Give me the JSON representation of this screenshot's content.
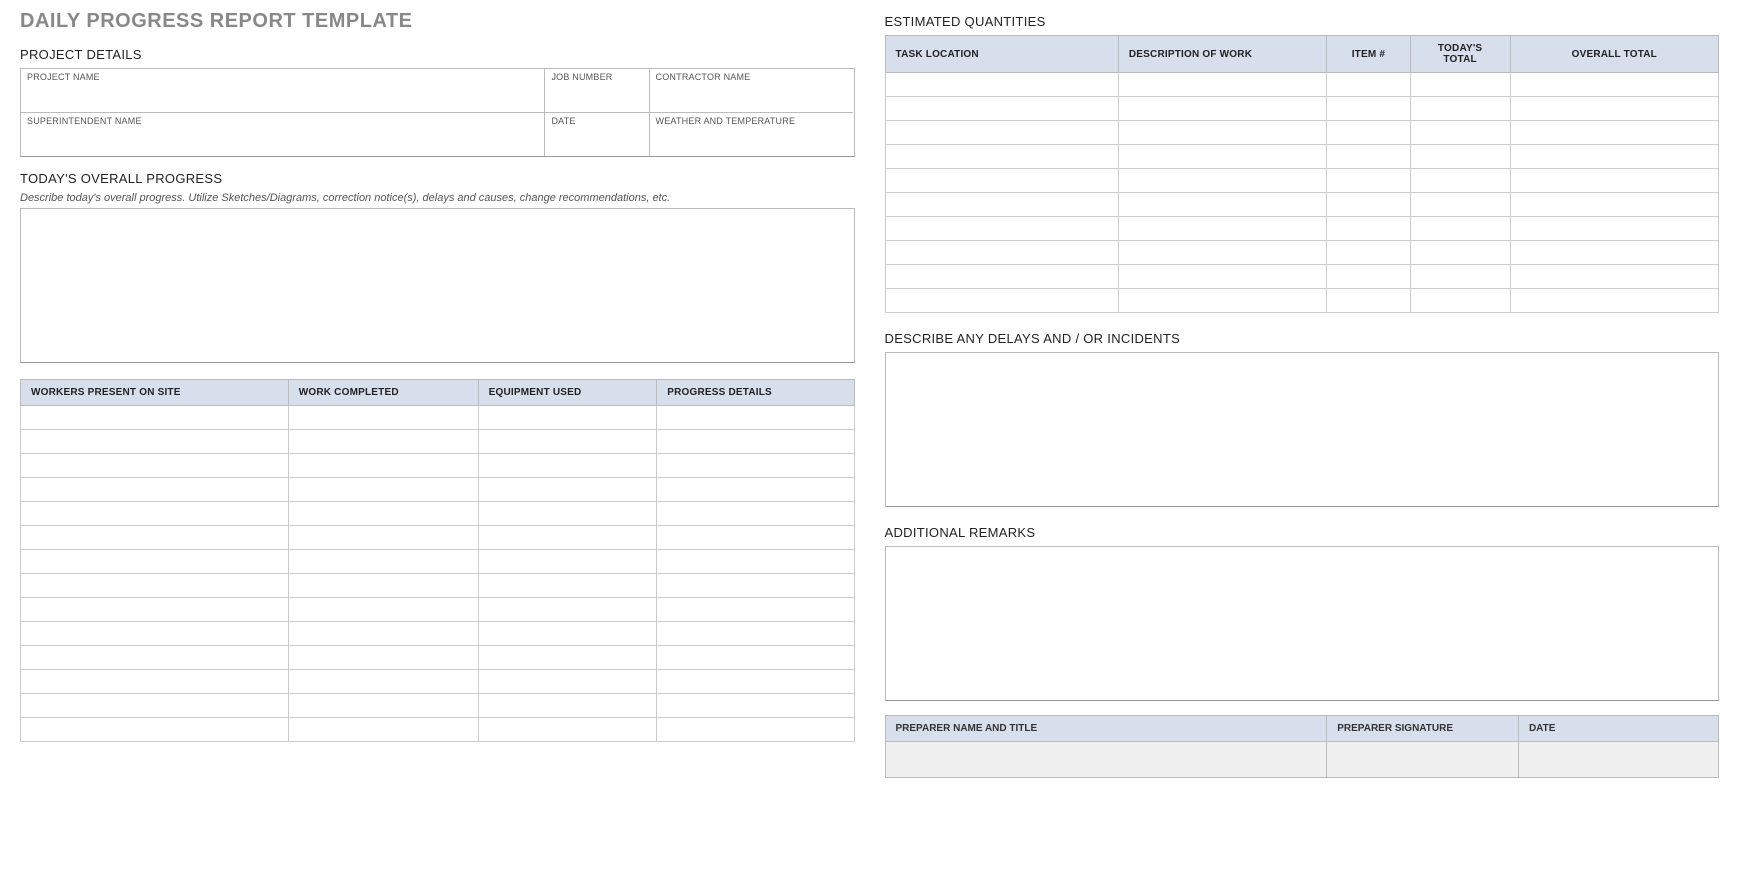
{
  "title": "DAILY PROGRESS REPORT TEMPLATE",
  "project_details": {
    "heading": "PROJECT DETAILS",
    "labels": {
      "project_name": "PROJECT NAME",
      "job_number": "JOB NUMBER",
      "contractor_name": "CONTRACTOR NAME",
      "superintendent_name": "SUPERINTENDENT NAME",
      "date": "DATE",
      "weather_temp": "WEATHER AND TEMPERATURE"
    },
    "values": {
      "project_name": "",
      "job_number": "",
      "contractor_name": "",
      "superintendent_name": "",
      "date": "",
      "weather_temp": ""
    }
  },
  "overall_progress": {
    "heading": "TODAY'S OVERALL PROGRESS",
    "instruction": "Describe today's overall progress.  Utilize Sketches/Diagrams, correction notice(s), delays and causes, change recommendations, etc.",
    "value": ""
  },
  "progress_table": {
    "headers": [
      "WORKERS PRESENT ON SITE",
      "WORK COMPLETED",
      "EQUIPMENT USED",
      "PROGRESS DETAILS"
    ],
    "rows": [
      [
        "",
        "",
        "",
        ""
      ],
      [
        "",
        "",
        "",
        ""
      ],
      [
        "",
        "",
        "",
        ""
      ],
      [
        "",
        "",
        "",
        ""
      ],
      [
        "",
        "",
        "",
        ""
      ],
      [
        "",
        "",
        "",
        ""
      ],
      [
        "",
        "",
        "",
        ""
      ],
      [
        "",
        "",
        "",
        ""
      ],
      [
        "",
        "",
        "",
        ""
      ],
      [
        "",
        "",
        "",
        ""
      ],
      [
        "",
        "",
        "",
        ""
      ],
      [
        "",
        "",
        "",
        ""
      ],
      [
        "",
        "",
        "",
        ""
      ],
      [
        "",
        "",
        "",
        ""
      ]
    ]
  },
  "est_quantities": {
    "heading": "ESTIMATED QUANTITIES",
    "headers": [
      "TASK LOCATION",
      "DESCRIPTION OF WORK",
      "ITEM #",
      "TODAY'S TOTAL",
      "OVERALL TOTAL"
    ],
    "rows": [
      [
        "",
        "",
        "",
        "",
        ""
      ],
      [
        "",
        "",
        "",
        "",
        ""
      ],
      [
        "",
        "",
        "",
        "",
        ""
      ],
      [
        "",
        "",
        "",
        "",
        ""
      ],
      [
        "",
        "",
        "",
        "",
        ""
      ],
      [
        "",
        "",
        "",
        "",
        ""
      ],
      [
        "",
        "",
        "",
        "",
        ""
      ],
      [
        "",
        "",
        "",
        "",
        ""
      ],
      [
        "",
        "",
        "",
        "",
        ""
      ],
      [
        "",
        "",
        "",
        "",
        ""
      ]
    ]
  },
  "delays": {
    "heading": "DESCRIBE ANY DELAYS AND / OR INCIDENTS",
    "value": ""
  },
  "remarks": {
    "heading": "ADDITIONAL REMARKS",
    "value": ""
  },
  "preparer": {
    "headers": [
      "PREPARER NAME AND TITLE",
      "PREPARER SIGNATURE",
      "DATE"
    ],
    "values": [
      "",
      "",
      ""
    ]
  }
}
